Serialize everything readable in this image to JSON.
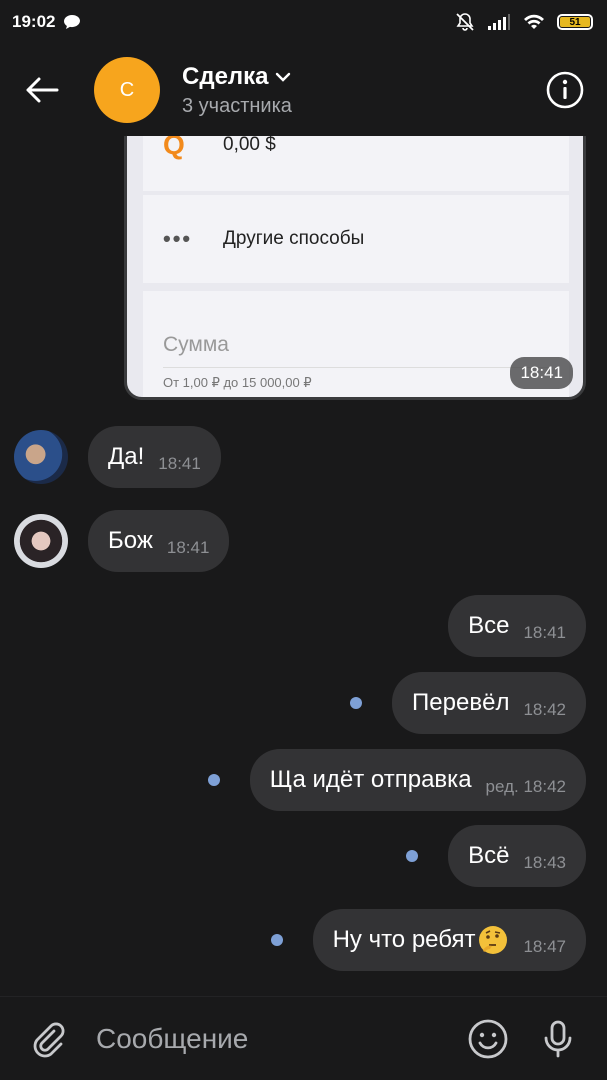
{
  "status": {
    "time": "19:02",
    "battery": "51"
  },
  "header": {
    "avatar_letter": "С",
    "title": "Сделка",
    "subtitle": "3 участника"
  },
  "card": {
    "qiwi_amount": "0,00 $",
    "other_label": "Другие способы",
    "sum_label": "Сумма",
    "sum_hint": "От 1,00 ₽ до 15 000,00 ₽",
    "time": "18:41"
  },
  "messages": [
    {
      "text": "Да!",
      "time": "18:41"
    },
    {
      "text": "Бож",
      "time": "18:41"
    },
    {
      "text": "Все",
      "time": "18:41"
    },
    {
      "text": "Перевёл",
      "time": "18:42"
    },
    {
      "text": "Ща идёт отправка",
      "time": "ред. 18:42"
    },
    {
      "text": "Всё",
      "time": "18:43"
    },
    {
      "text": "Ну что ребят",
      "time": "18:47"
    }
  ],
  "composer": {
    "placeholder": "Сообщение"
  },
  "colors": {
    "accent": "#f7a51d",
    "unread_dot": "#7ea0d6",
    "bubble": "#333335",
    "background": "#19191a"
  }
}
